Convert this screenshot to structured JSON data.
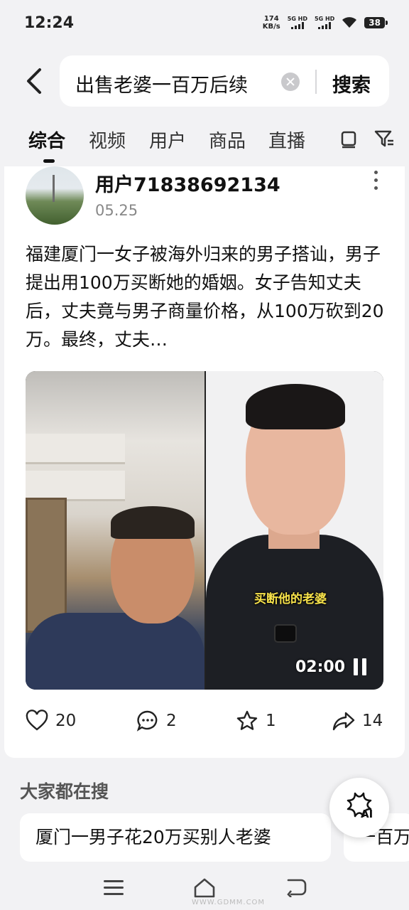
{
  "status_bar": {
    "time": "12:24",
    "net_speed_value": "174",
    "net_speed_unit": "KB/s",
    "sim1": "5G HD",
    "sim2": "5G HD",
    "battery": "38"
  },
  "search": {
    "query": "出售老婆一百万后续",
    "button_label": "搜索"
  },
  "tabs": [
    {
      "label": "综合",
      "active": true
    },
    {
      "label": "视频"
    },
    {
      "label": "用户"
    },
    {
      "label": "商品"
    },
    {
      "label": "直播"
    }
  ],
  "post": {
    "username": "用户71838692134",
    "date": "05.25",
    "text": "福建厦门一女子被海外归来的男子搭讪，男子提出用100万买断她的婚姻。女子告知丈夫后，丈夫竟与男子商量价格，从100万砍到20万。最终，丈夫…",
    "video": {
      "caption": "买断他的老婆",
      "duration": "02:00"
    },
    "likes": "20",
    "comments": "2",
    "favorites": "1",
    "shares": "14"
  },
  "trending": {
    "title": "大家都在搜",
    "chips": [
      "厦门一男子花20万买别人老婆",
      "一百万"
    ]
  },
  "ai_button": {
    "label": "AI"
  },
  "watermark": "WWW.GDMM.COM",
  "colors": {
    "background": "#f2f2f4",
    "card": "#ffffff",
    "caption_yellow": "#f7e24a"
  }
}
